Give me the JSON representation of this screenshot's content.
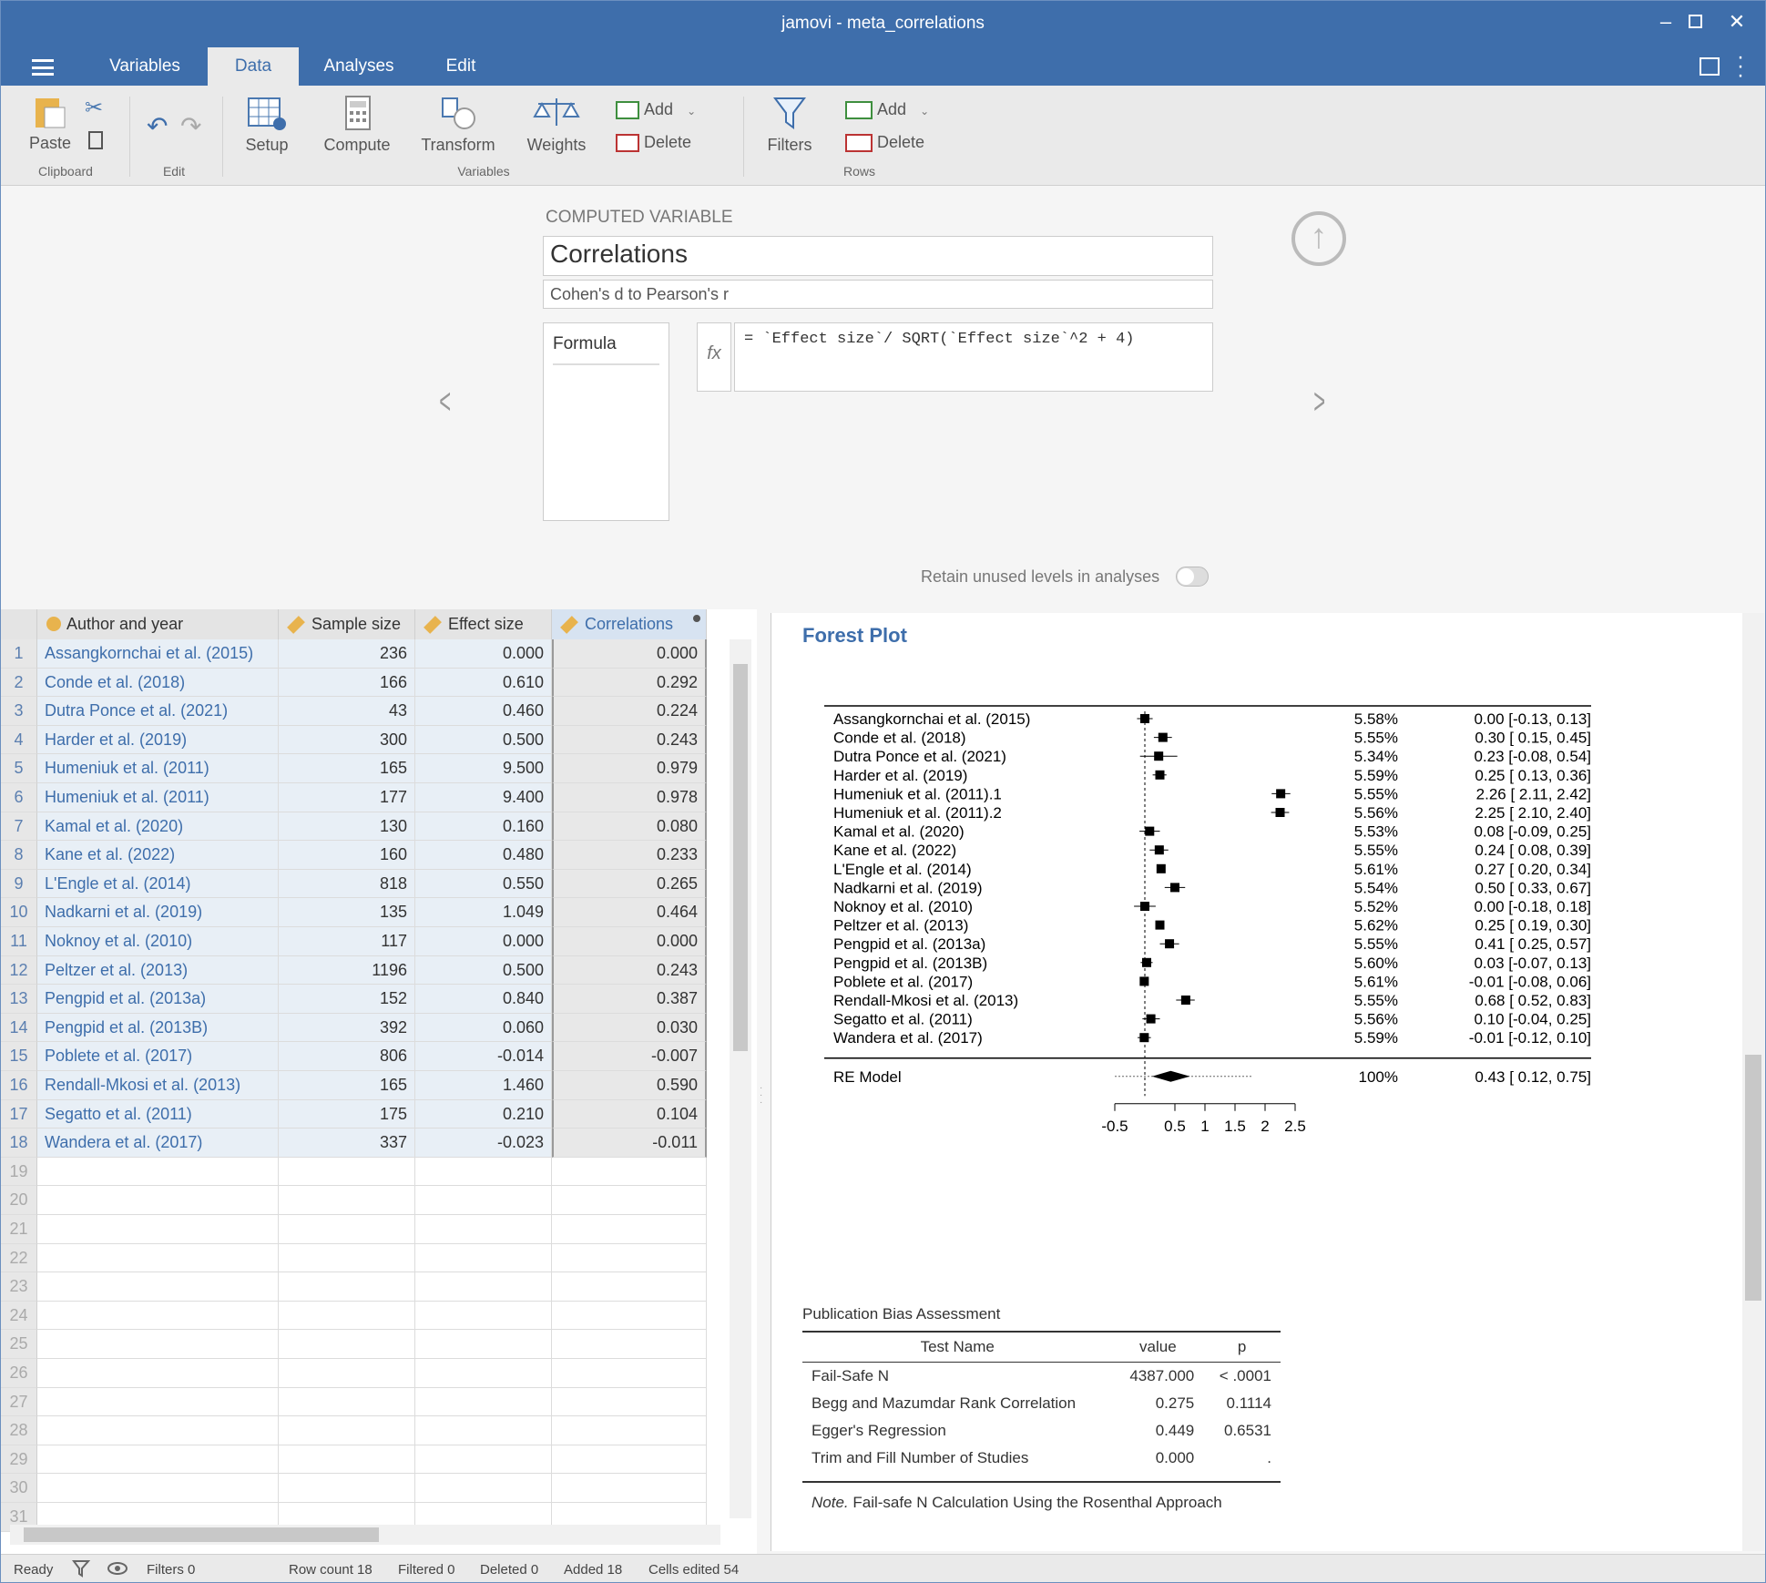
{
  "window": {
    "title": "jamovi - meta_correlations"
  },
  "menu": {
    "tabs": [
      "Variables",
      "Data",
      "Analyses",
      "Edit"
    ]
  },
  "ribbon": {
    "paste": "Paste",
    "clipboard": "Clipboard",
    "edit": "Edit",
    "setup": "Setup",
    "compute": "Compute",
    "transform": "Transform",
    "weights": "Weights",
    "variables": "Variables",
    "var_add": "Add",
    "var_delete": "Delete",
    "filters": "Filters",
    "row_add": "Add",
    "row_delete": "Delete",
    "rows": "Rows"
  },
  "setup": {
    "heading": "COMPUTED VARIABLE",
    "name": "Correlations",
    "description": "Cohen's d to Pearson's r",
    "formula_tab": "Formula",
    "fx": "fx",
    "formula": "= `Effect size`/ SQRT(`Effect size`^2 + 4)",
    "retain": "Retain unused levels in analyses"
  },
  "grid": {
    "columns": [
      "Author and year",
      "Sample size",
      "Effect size",
      "Correlations"
    ],
    "rows": [
      [
        "Assangkornchai et al. (2015)",
        "236",
        "0.000",
        "0.000"
      ],
      [
        "Conde et al. (2018)",
        "166",
        "0.610",
        "0.292"
      ],
      [
        "Dutra Ponce et al. (2021)",
        "43",
        "0.460",
        "0.224"
      ],
      [
        "Harder et al. (2019)",
        "300",
        "0.500",
        "0.243"
      ],
      [
        "Humeniuk et al. (2011)",
        "165",
        "9.500",
        "0.979"
      ],
      [
        "Humeniuk et al. (2011)",
        "177",
        "9.400",
        "0.978"
      ],
      [
        "Kamal et al. (2020)",
        "130",
        "0.160",
        "0.080"
      ],
      [
        "Kane et al. (2022)",
        "160",
        "0.480",
        "0.233"
      ],
      [
        "L'Engle et al. (2014)",
        "818",
        "0.550",
        "0.265"
      ],
      [
        "Nadkarni et al. (2019)",
        "135",
        "1.049",
        "0.464"
      ],
      [
        "Noknoy et al. (2010)",
        "117",
        "0.000",
        "0.000"
      ],
      [
        "Peltzer et al. (2013)",
        "1196",
        "0.500",
        "0.243"
      ],
      [
        "Pengpid et al. (2013a)",
        "152",
        "0.840",
        "0.387"
      ],
      [
        "Pengpid et al. (2013B)",
        "392",
        "0.060",
        "0.030"
      ],
      [
        "Poblete et al. (2017)",
        "806",
        "-0.014",
        "-0.007"
      ],
      [
        "Rendall-Mkosi et al. (2013)",
        "165",
        "1.460",
        "0.590"
      ],
      [
        "Segatto et al. (2011)",
        "175",
        "0.210",
        "0.104"
      ],
      [
        "Wandera et al. (2017)",
        "337",
        "-0.023",
        "-0.011"
      ]
    ],
    "empty_rows": [
      "19",
      "20",
      "21",
      "22",
      "23",
      "24",
      "25",
      "26",
      "27",
      "28",
      "29",
      "30",
      "31"
    ]
  },
  "status": {
    "ready": "Ready",
    "filters": "Filters 0",
    "row_count": "Row count 18",
    "filtered": "Filtered 0",
    "deleted": "Deleted 0",
    "added": "Added 18",
    "cells_edited": "Cells edited 54"
  },
  "forest": {
    "title": "Forest Plot",
    "studies": [
      {
        "name": "Assangkornchai et al. (2015)",
        "weight": "5.58%",
        "ci_text": "0.00 [-0.13, 0.13]",
        "est": 0.0,
        "lo": -0.13,
        "hi": 0.13
      },
      {
        "name": "Conde et al. (2018)",
        "weight": "5.55%",
        "ci_text": "0.30 [ 0.15, 0.45]",
        "est": 0.3,
        "lo": 0.15,
        "hi": 0.45
      },
      {
        "name": "Dutra Ponce et al. (2021)",
        "weight": "5.34%",
        "ci_text": "0.23 [-0.08, 0.54]",
        "est": 0.23,
        "lo": -0.08,
        "hi": 0.54
      },
      {
        "name": "Harder et al. (2019)",
        "weight": "5.59%",
        "ci_text": "0.25 [ 0.13, 0.36]",
        "est": 0.25,
        "lo": 0.13,
        "hi": 0.36
      },
      {
        "name": "Humeniuk et al. (2011).1",
        "weight": "5.55%",
        "ci_text": "2.26 [ 2.11, 2.42]",
        "est": 2.26,
        "lo": 2.11,
        "hi": 2.42
      },
      {
        "name": "Humeniuk et al. (2011).2",
        "weight": "5.56%",
        "ci_text": "2.25 [ 2.10, 2.40]",
        "est": 2.25,
        "lo": 2.1,
        "hi": 2.4
      },
      {
        "name": "Kamal et al. (2020)",
        "weight": "5.53%",
        "ci_text": "0.08 [-0.09, 0.25]",
        "est": 0.08,
        "lo": -0.09,
        "hi": 0.25
      },
      {
        "name": "Kane et al. (2022)",
        "weight": "5.55%",
        "ci_text": "0.24 [ 0.08, 0.39]",
        "est": 0.24,
        "lo": 0.08,
        "hi": 0.39
      },
      {
        "name": "L'Engle et al. (2014)",
        "weight": "5.61%",
        "ci_text": "0.27 [ 0.20, 0.34]",
        "est": 0.27,
        "lo": 0.2,
        "hi": 0.34
      },
      {
        "name": "Nadkarni et al. (2019)",
        "weight": "5.54%",
        "ci_text": "0.50 [ 0.33, 0.67]",
        "est": 0.5,
        "lo": 0.33,
        "hi": 0.67
      },
      {
        "name": "Noknoy et al. (2010)",
        "weight": "5.52%",
        "ci_text": "0.00 [-0.18, 0.18]",
        "est": 0.0,
        "lo": -0.18,
        "hi": 0.18
      },
      {
        "name": "Peltzer et al. (2013)",
        "weight": "5.62%",
        "ci_text": "0.25 [ 0.19, 0.30]",
        "est": 0.25,
        "lo": 0.19,
        "hi": 0.3
      },
      {
        "name": "Pengpid et al. (2013a)",
        "weight": "5.55%",
        "ci_text": "0.41 [ 0.25, 0.57]",
        "est": 0.41,
        "lo": 0.25,
        "hi": 0.57
      },
      {
        "name": "Pengpid et al. (2013B)",
        "weight": "5.60%",
        "ci_text": "0.03 [-0.07, 0.13]",
        "est": 0.03,
        "lo": -0.07,
        "hi": 0.13
      },
      {
        "name": "Poblete et al. (2017)",
        "weight": "5.61%",
        "ci_text": "-0.01 [-0.08, 0.06]",
        "est": -0.01,
        "lo": -0.08,
        "hi": 0.06
      },
      {
        "name": "Rendall-Mkosi et al. (2013)",
        "weight": "5.55%",
        "ci_text": "0.68 [ 0.52, 0.83]",
        "est": 0.68,
        "lo": 0.52,
        "hi": 0.83
      },
      {
        "name": "Segatto et al. (2011)",
        "weight": "5.56%",
        "ci_text": "0.10 [-0.04, 0.25]",
        "est": 0.1,
        "lo": -0.04,
        "hi": 0.25
      },
      {
        "name": "Wandera et al. (2017)",
        "weight": "5.59%",
        "ci_text": "-0.01 [-0.12, 0.10]",
        "est": -0.01,
        "lo": -0.12,
        "hi": 0.1
      }
    ],
    "model": {
      "name": "RE Model",
      "weight": "100%",
      "ci_text": "0.43 [ 0.12, 0.75]",
      "est": 0.43,
      "lo": 0.12,
      "hi": 0.75,
      "pi_lo": -0.5,
      "pi_hi": 1.8
    },
    "ticks": [
      "-0.5",
      "0.5",
      "1",
      "1.5",
      "2",
      "2.5"
    ],
    "tick_values": [
      -0.5,
      0.5,
      1,
      1.5,
      2,
      2.5
    ],
    "xlim": [
      -0.5,
      2.5
    ]
  },
  "bias": {
    "title": "Publication Bias Assessment",
    "headers": [
      "Test Name",
      "value",
      "p"
    ],
    "rows": [
      [
        "Fail-Safe N",
        "4387.000",
        "< .0001"
      ],
      [
        "Begg and Mazumdar Rank Correlation",
        "0.275",
        "0.1114"
      ],
      [
        "Egger's Regression",
        "0.449",
        "0.6531"
      ],
      [
        "Trim and Fill Number of Studies",
        "0.000",
        "."
      ]
    ],
    "note_label": "Note.",
    "note": "Fail-safe N Calculation Using the Rosenthal Approach"
  }
}
